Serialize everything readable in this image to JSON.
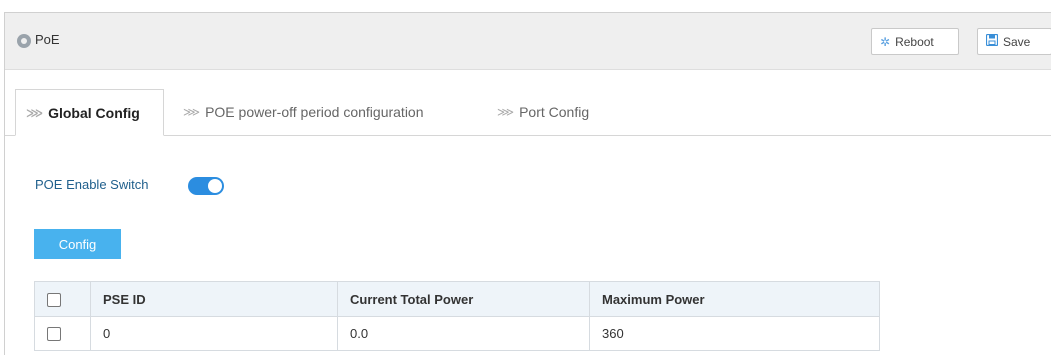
{
  "header": {
    "title": "PoE",
    "title_icon": "location-pin-icon",
    "reboot_label": "Reboot",
    "reboot_icon": "spinner-icon",
    "save_label": "Save",
    "save_icon": "floppy-disk-icon"
  },
  "tabs": [
    {
      "label": "Global Config",
      "active": true
    },
    {
      "label": "POE power-off period configuration",
      "active": false
    },
    {
      "label": "Port Config",
      "active": false
    }
  ],
  "global": {
    "switch_label": "POE Enable Switch",
    "switch_on": true,
    "config_button": "Config"
  },
  "table": {
    "columns": [
      "PSE ID",
      "Current Total Power",
      "Maximum Power"
    ],
    "rows": [
      {
        "pse_id": "0",
        "current_total_power": "0.0",
        "maximum_power": "360"
      }
    ]
  },
  "colors": {
    "accent": "#2b8de0",
    "button": "#48b2ee",
    "header_bg": "#efefef",
    "table_header_bg": "#eef4f9"
  }
}
